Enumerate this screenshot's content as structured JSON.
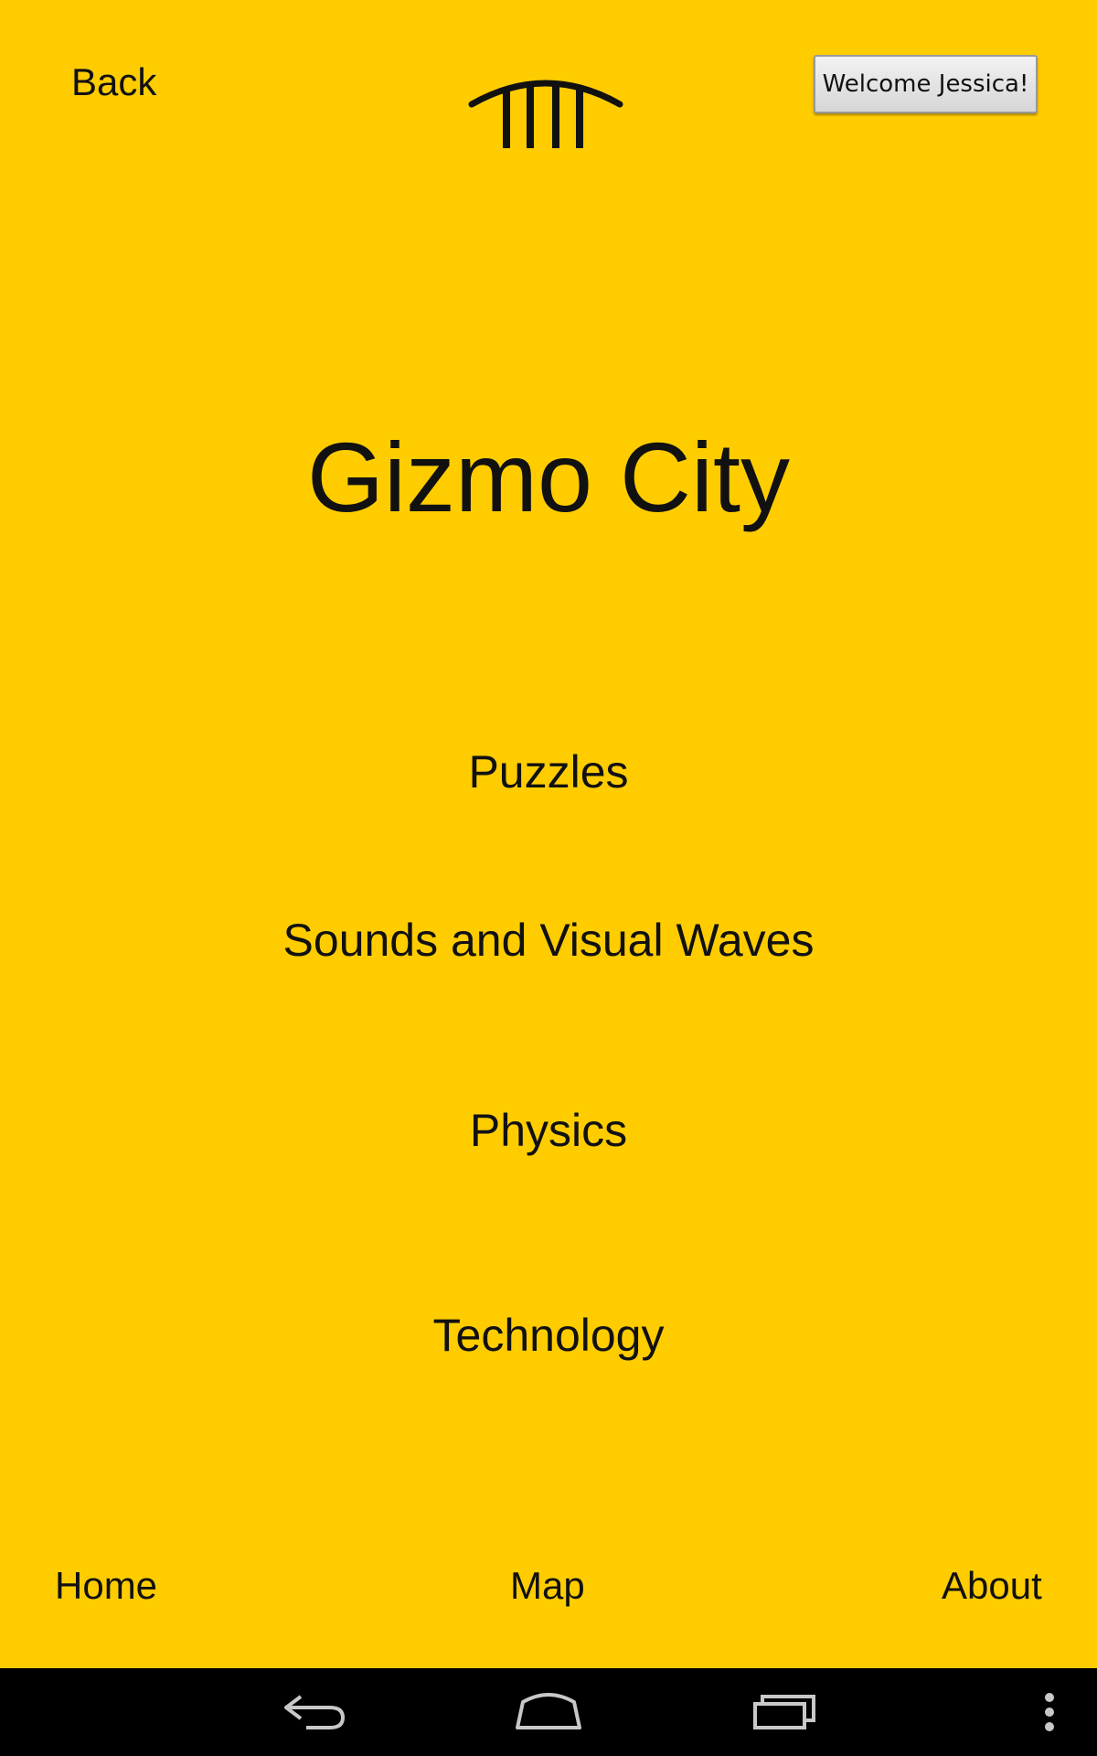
{
  "header": {
    "back_label": "Back",
    "logo_icon": "arch-columns-logo-icon",
    "welcome_label": "Welcome Jessica!"
  },
  "main": {
    "title": "Gizmo City",
    "menu_items": [
      {
        "label": "Puzzles"
      },
      {
        "label": "Sounds and Visual Waves"
      },
      {
        "label": "Physics"
      },
      {
        "label": "Technology"
      }
    ]
  },
  "footer": {
    "home_label": "Home",
    "map_label": "Map",
    "about_label": "About"
  },
  "system_nav": {
    "icons": [
      "back-icon",
      "home-icon",
      "recent-apps-icon",
      "overflow-menu-icon"
    ]
  },
  "colors": {
    "background": "#FFCC00",
    "text": "#111111",
    "navbar": "#000000"
  }
}
